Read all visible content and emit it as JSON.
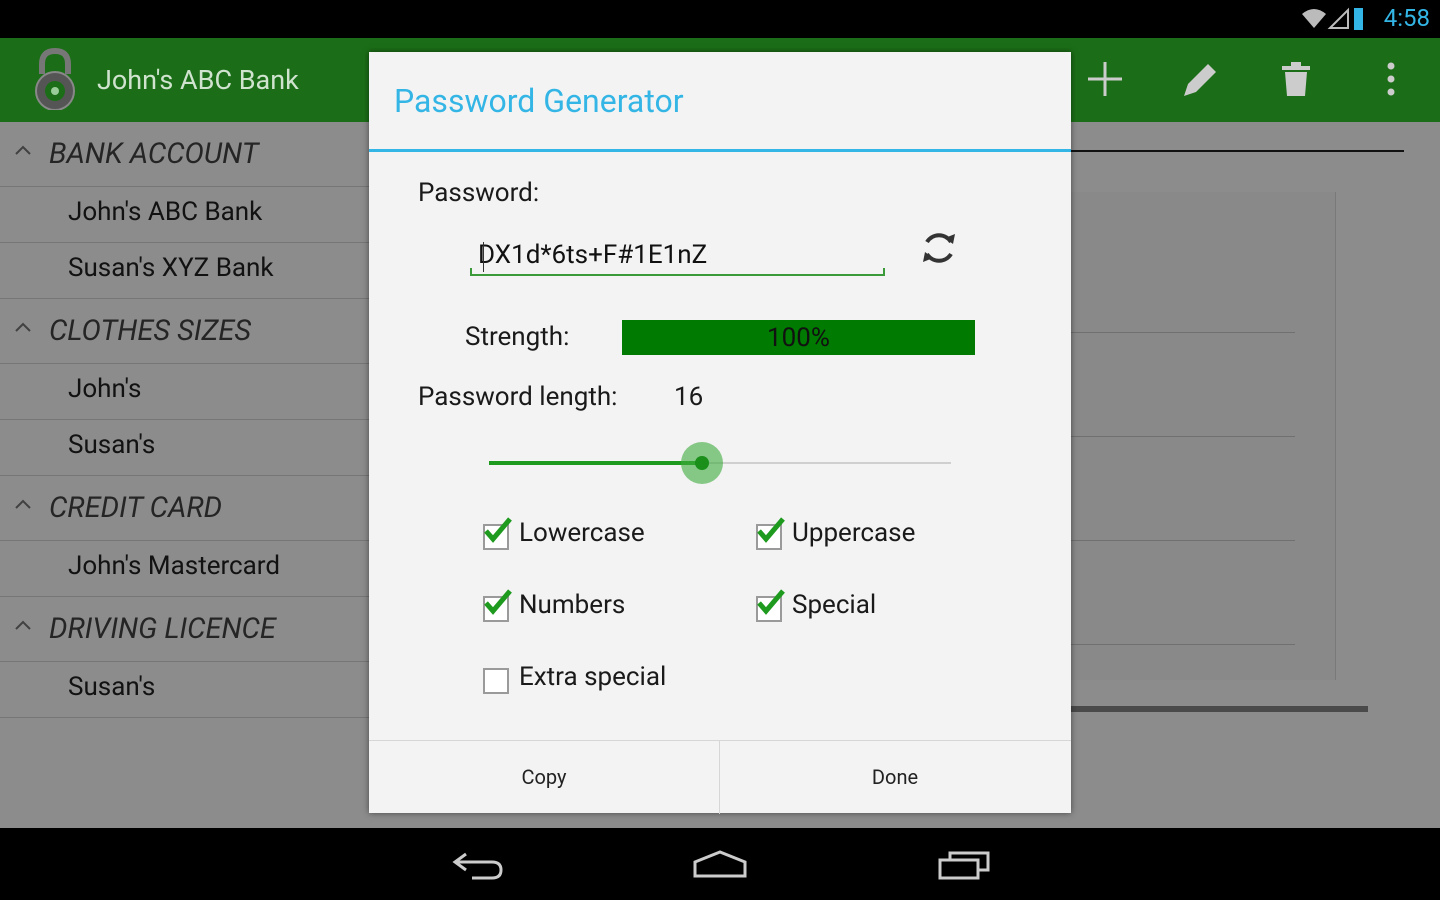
{
  "status_bar": {
    "time": "4:58"
  },
  "action_bar": {
    "title": "John's ABC Bank"
  },
  "list": {
    "sections": [
      {
        "header": "BANK ACCOUNT",
        "items": [
          "John's ABC Bank",
          "Susan's XYZ Bank"
        ]
      },
      {
        "header": "CLOTHES SIZES",
        "items": [
          "John's",
          "Susan's"
        ]
      },
      {
        "header": "CREDIT CARD",
        "items": [
          "John's Mastercard"
        ]
      },
      {
        "header": "DRIVING LICENCE",
        "items": [
          "Susan's"
        ]
      }
    ]
  },
  "dialog": {
    "title": "Password Generator",
    "password_label": "Password:",
    "password_value": "DX1d*6ts+F#1E1nZ",
    "strength_label": "Strength:",
    "strength_text": "100%",
    "strength_percent": 100,
    "length_label": "Password length:",
    "length_value": "16",
    "length_slider_fraction": 0.46,
    "options": {
      "lowercase": {
        "label": "Lowercase",
        "checked": true
      },
      "uppercase": {
        "label": "Uppercase",
        "checked": true
      },
      "numbers": {
        "label": "Numbers",
        "checked": true
      },
      "special": {
        "label": "Special",
        "checked": true
      },
      "extra_special": {
        "label": "Extra special",
        "checked": false
      }
    },
    "copy_button": "Copy",
    "done_button": "Done"
  },
  "colors": {
    "accent": "#33b5e5",
    "action_bar": "#1b6e17",
    "strength": "#007a00"
  }
}
